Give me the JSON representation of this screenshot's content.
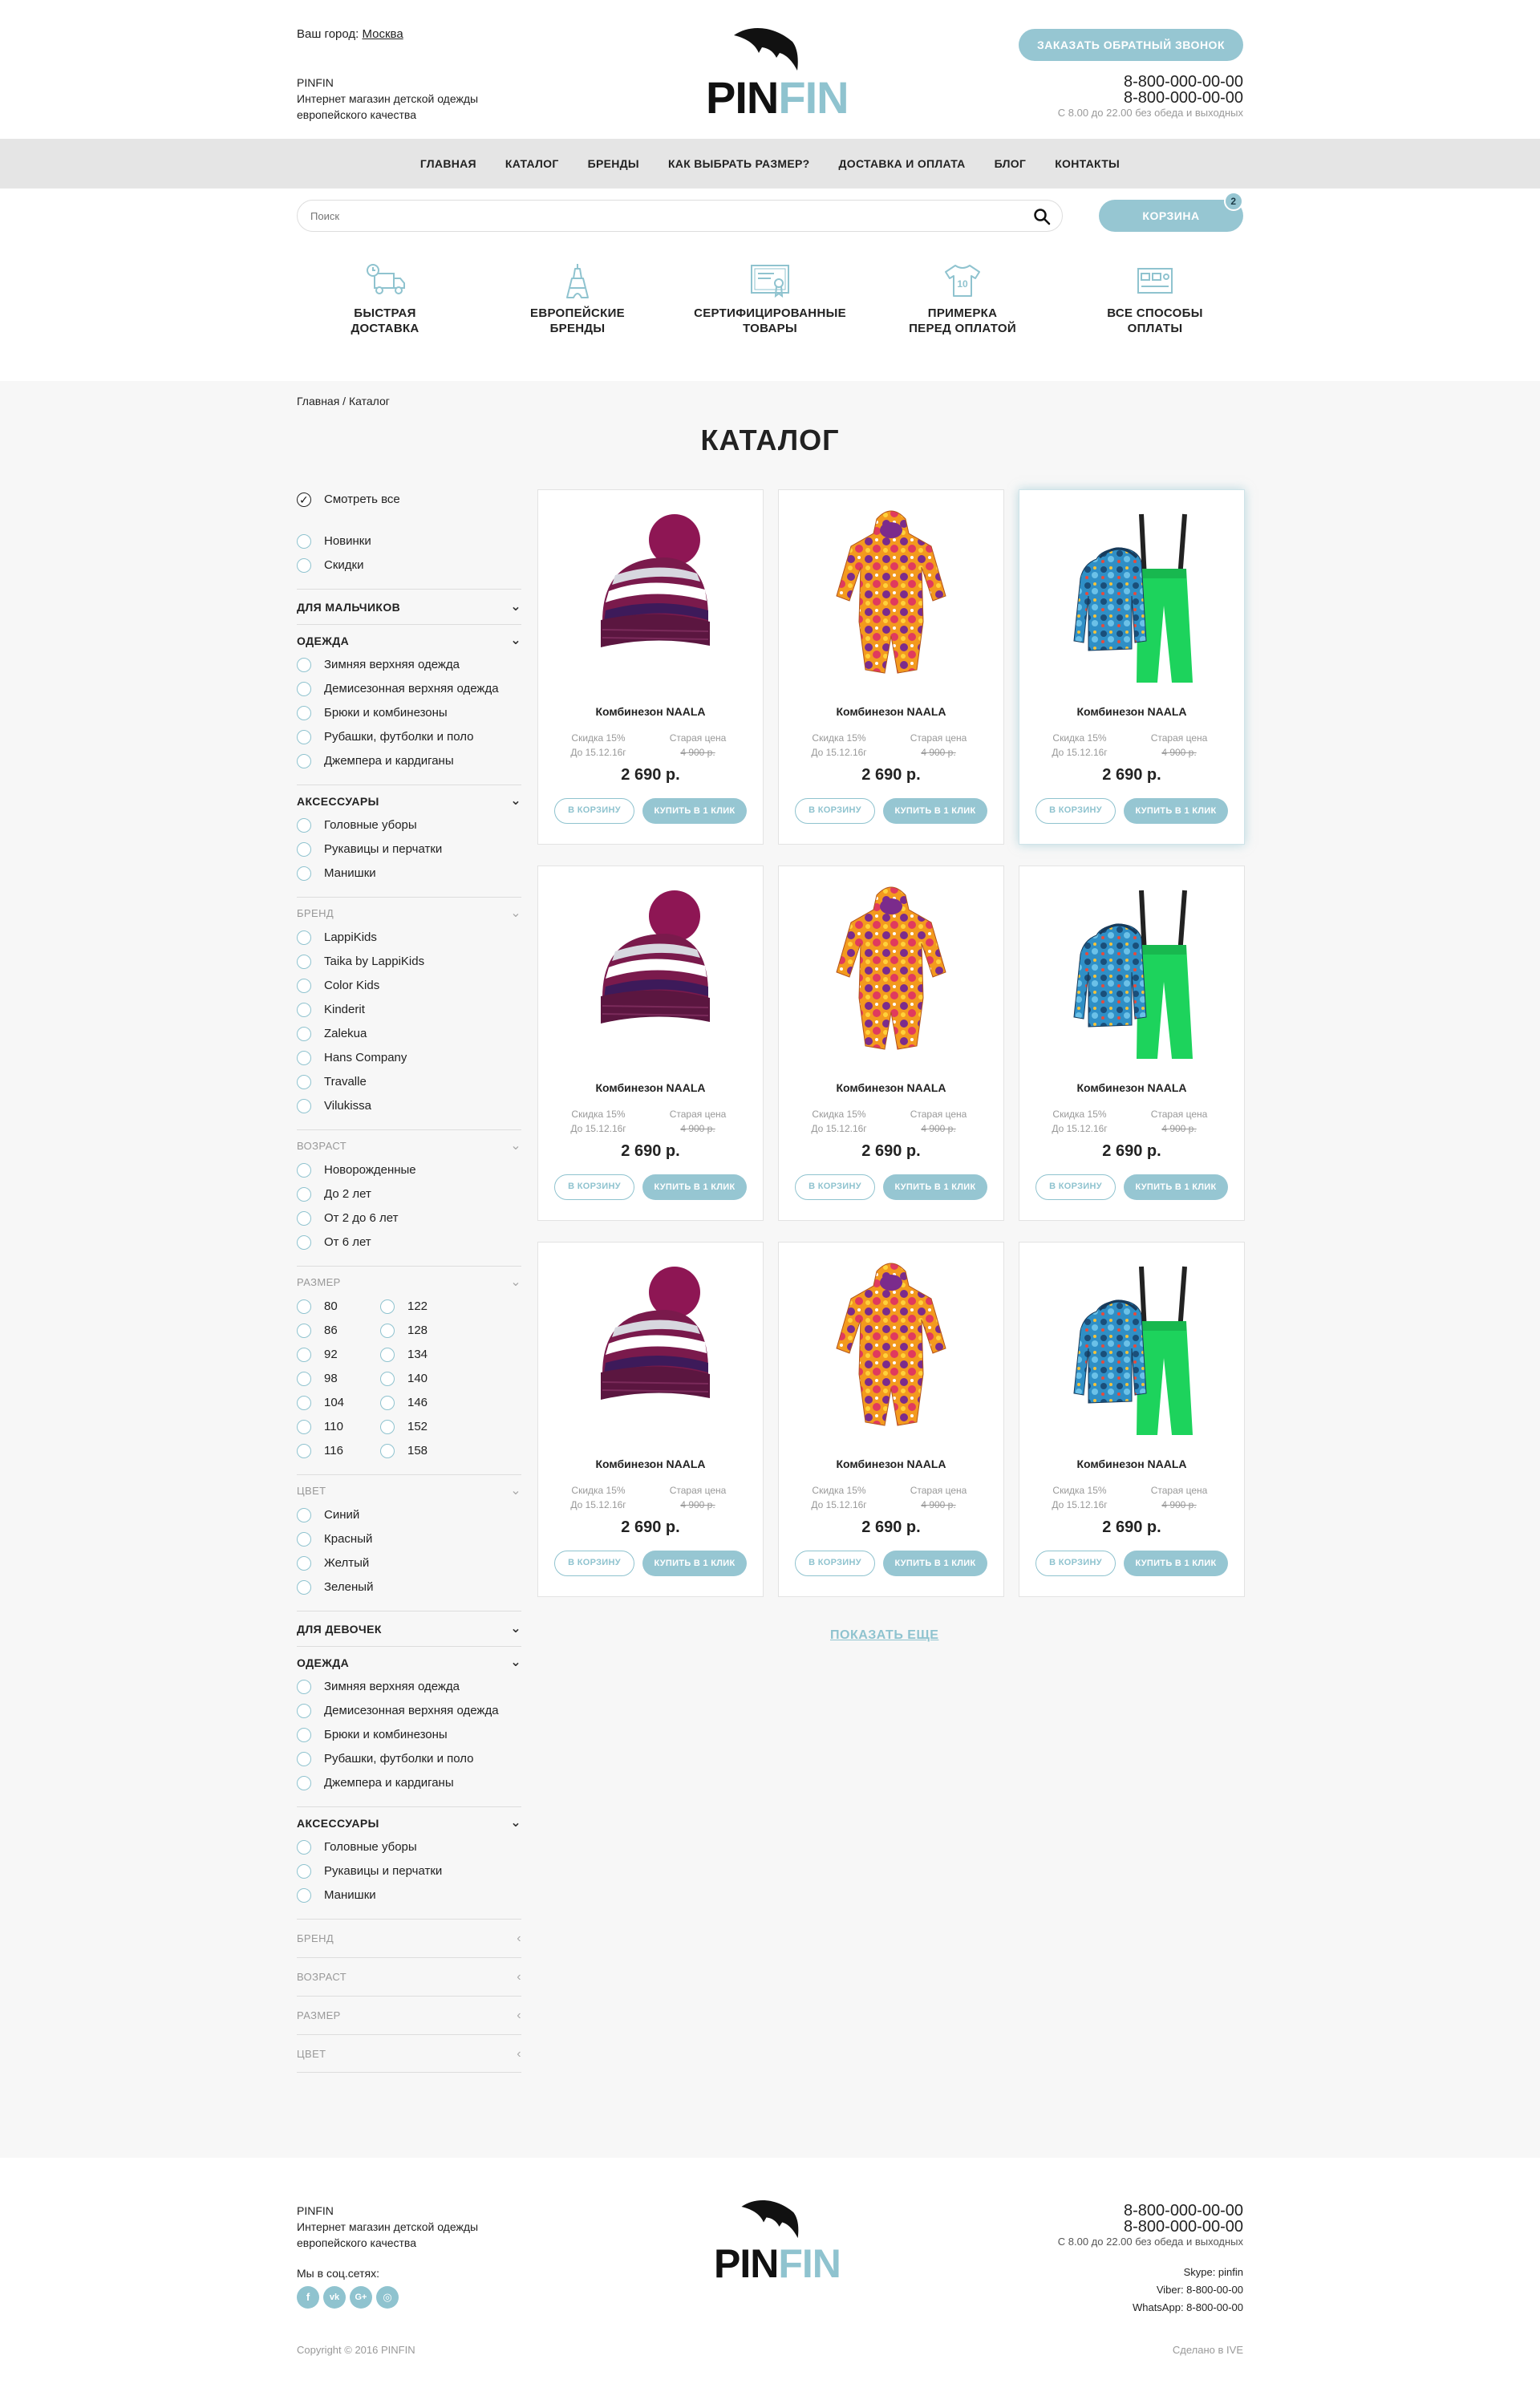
{
  "header": {
    "city_label": "Ваш город:",
    "city": "Москва",
    "brand_name": "PINFIN",
    "brand_desc": "Интернет магазин детской одежды европейского качества",
    "logo_pin": "PIN",
    "logo_fin": "FIN",
    "callback": "ЗАКАЗАТЬ ОБРАТНЫЙ ЗВОНОК",
    "phone1": "8-800-000-00-00",
    "phone2": "8-800-000-00-00",
    "hours": "С 8.00 до 22.00 без обеда и выходных"
  },
  "nav": [
    "ГЛАВНАЯ",
    "КАТАЛОГ",
    "БРЕНДЫ",
    "КАК ВЫБРАТЬ РАЗМЕР?",
    "ДОСТАВКА И ОПЛАТА",
    "БЛОГ",
    "КОНТАКТЫ"
  ],
  "search": {
    "placeholder": "Поиск"
  },
  "cart": {
    "label": "КОРЗИНА",
    "count": "2"
  },
  "features": [
    {
      "l1": "БЫСТРАЯ",
      "l2": "ДОСТАВКА",
      "icon": "truck-icon"
    },
    {
      "l1": "ЕВРОПЕЙСКИЕ",
      "l2": "БРЕНДЫ",
      "icon": "eiffel-tower-icon"
    },
    {
      "l1": "СЕРТИФИЦИРОВАННЫЕ",
      "l2": "ТОВАРЫ",
      "icon": "certificate-icon"
    },
    {
      "l1": "ПРИМЕРКА",
      "l2": "ПЕРЕД ОПЛАТОЙ",
      "icon": "tshirt-icon"
    },
    {
      "l1": "ВСЕ СПОСОБЫ",
      "l2": "ОПЛАТЫ",
      "icon": "payment-card-icon"
    }
  ],
  "breadcrumb": "Главная / Каталог",
  "page_title": "КАТАЛОГ",
  "sidebar": {
    "view_all": "Смотреть все",
    "top_options": [
      "Новинки",
      "Скидки"
    ],
    "boys": "ДЛЯ МАЛЬЧИКОВ",
    "clothes": "ОДЕЖДА",
    "clothes_items": [
      "Зимняя верхняя одежда",
      "Демисезонная верхняя одежда",
      "Брюки и комбинезоны",
      "Рубашки, футболки и поло",
      "Джемпера и кардиганы"
    ],
    "accessories": "АКСЕССУАРЫ",
    "acc_items": [
      "Головные уборы",
      "Рукавицы и перчатки",
      "Манишки"
    ],
    "brand": "БРЕНД",
    "brand_items": [
      "LappiKids",
      "Taika by LappiKids",
      "Color Kids",
      "Kinderit",
      "Zalekua",
      "Hans Company",
      "Travalle",
      "Vilukissa"
    ],
    "age": "ВОЗРАСТ",
    "age_items": [
      "Новорожденные",
      "До 2 лет",
      "От 2 до 6 лет",
      "От 6 лет"
    ],
    "size": "РАЗМЕР",
    "size_col1": [
      "80",
      "86",
      "92",
      "98",
      "104",
      "110",
      "116"
    ],
    "size_col2": [
      "122",
      "128",
      "134",
      "140",
      "146",
      "152",
      "158"
    ],
    "color": "ЦВЕТ",
    "color_items": [
      "Синий",
      "Красный",
      "Желтый",
      "Зеленый"
    ],
    "girls": "ДЛЯ ДЕВОЧЕК"
  },
  "products": [
    {
      "name": "Комбинезон NAALA",
      "img": "hat"
    },
    {
      "name": "Комбинезон NAALA",
      "img": "suit"
    },
    {
      "name": "Комбинезон NAALA",
      "img": "set"
    },
    {
      "name": "Комбинезон NAALA",
      "img": "hat"
    },
    {
      "name": "Комбинезон NAALA",
      "img": "suit"
    },
    {
      "name": "Комбинезон NAALA",
      "img": "set"
    },
    {
      "name": "Комбинезон NAALA",
      "img": "hat"
    },
    {
      "name": "Комбинезон NAALA",
      "img": "suit"
    },
    {
      "name": "Комбинезон NAALA",
      "img": "set"
    }
  ],
  "product_common": {
    "discount": "Скидка 15%",
    "until": "До 15.12.16г",
    "old_label": "Старая цена",
    "old_price": "4 900 р.",
    "price": "2 690 р.",
    "to_cart": "В КОРЗИНУ",
    "buy_one": "КУПИТЬ В 1 КЛИК"
  },
  "show_more": "ПОКАЗАТЬ ЕЩЕ",
  "footer": {
    "brand_name": "PINFIN",
    "brand_desc": "Интернет магазин детской одежды европейского качества",
    "social_label": "Мы в соц.сетях:",
    "social": [
      "f",
      "vk",
      "G+",
      "◎"
    ],
    "phone1": "8-800-000-00-00",
    "phone2": "8-800-000-00-00",
    "hours": "С 8.00 до 22.00 без обеда и выходных",
    "skype": "Skype: pinfin",
    "viber": "Viber: 8-800-00-00",
    "whatsapp": "WhatsApp: 8-800-00-00",
    "copyright": "Copyright © 2016 PINFIN",
    "made_by": "Сделано в IVE"
  },
  "colors": {
    "accent": "#96c6d2",
    "nav_bg": "#e5e5e5",
    "page_bg": "#f7f7f7"
  }
}
